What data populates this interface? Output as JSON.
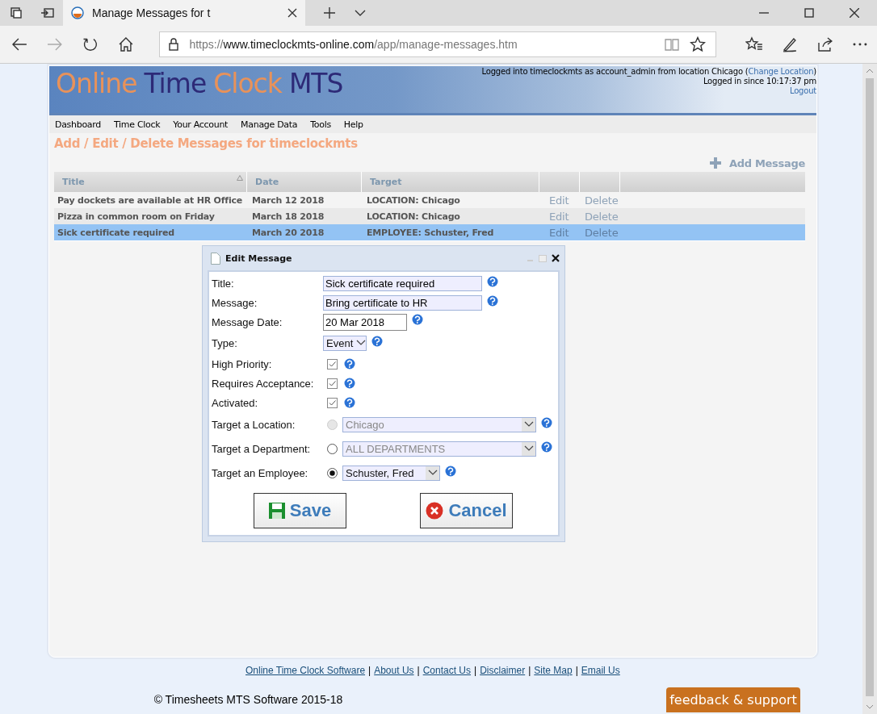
{
  "browser": {
    "tab_title": "Manage Messages for t",
    "url_scheme": "https://",
    "url_host": "www.timeclockmts-online.com",
    "url_path": "/app/manage-messages.htm"
  },
  "header": {
    "logo": [
      {
        "text": "Online",
        "kind": "accent"
      },
      {
        "text": "Time",
        "kind": "plain"
      },
      {
        "text": "Clock",
        "kind": "accent"
      },
      {
        "text": "MTS",
        "kind": "plain"
      }
    ],
    "session_before": "Logged into timeclockmts as account_admin from location Chicago (",
    "session_link": "Change Location",
    "session_after": ")",
    "since": "Logged in since 10:17:37 pm",
    "logout": "Logout"
  },
  "menu": [
    "Dashboard",
    "Time Clock",
    "Your Account",
    "Manage Data",
    "Tools",
    "Help"
  ],
  "heading": "Add / Edit / Delete Messages for timeclockmts",
  "add_message": "Add Message",
  "table": {
    "columns": [
      {
        "label": "Title",
        "sorted": true
      },
      {
        "label": "Date",
        "sorted": false
      },
      {
        "label": "Target",
        "sorted": false
      }
    ],
    "rows": [
      {
        "title": "Pay dockets are available at HR Office",
        "date": "March 12 2018",
        "target": "LOCATION: Chicago",
        "edit": "Edit",
        "delete": "Delete",
        "selected": false
      },
      {
        "title": "Pizza in common room on Friday",
        "date": "March 18 2018",
        "target": "LOCATION: Chicago",
        "edit": "Edit",
        "delete": "Delete",
        "selected": false
      },
      {
        "title": "Sick certificate required",
        "date": "March 20 2018",
        "target": "EMPLOYEE: Schuster, Fred",
        "edit": "Edit",
        "delete": "Delete",
        "selected": true
      }
    ]
  },
  "dialog": {
    "title": "Edit Message",
    "fields": [
      {
        "kind": "text",
        "label": "Title:",
        "value": "Sick certificate required"
      },
      {
        "kind": "text",
        "label": "Message:",
        "value": "Bring certificate to HR"
      },
      {
        "kind": "date",
        "label": "Message Date:",
        "value": "20 Mar 2018"
      },
      {
        "kind": "select",
        "label": "Type:",
        "value": "Event"
      },
      {
        "kind": "checkbox",
        "label": "High Priority:",
        "checked": true
      },
      {
        "kind": "checkbox",
        "label": "Requires Acceptance:",
        "checked": true
      },
      {
        "kind": "checkbox",
        "label": "Activated:",
        "checked": true
      },
      {
        "kind": "radio-select",
        "label": "Target a Location:",
        "value": "Chicago",
        "selected": false,
        "disabled": true,
        "select_disabled": true,
        "wide": true
      },
      {
        "kind": "radio-select",
        "label": "Target a Department:",
        "value": "ALL DEPARTMENTS",
        "selected": false,
        "disabled": false,
        "select_disabled": true,
        "wide": true
      },
      {
        "kind": "radio-select",
        "label": "Target an Employee:",
        "value": "Schuster, Fred",
        "selected": true,
        "disabled": false,
        "select_disabled": false,
        "wide": false
      }
    ],
    "save": "Save",
    "cancel": "Cancel"
  },
  "footer": {
    "links": [
      "Online Time Clock Software",
      "About Us",
      "Contact Us",
      "Disclaimer",
      "Site Map",
      "Email Us"
    ],
    "separator": "|",
    "copyright": "© Timesheets MTS Software 2015-18",
    "feedback": "feedback & support"
  }
}
